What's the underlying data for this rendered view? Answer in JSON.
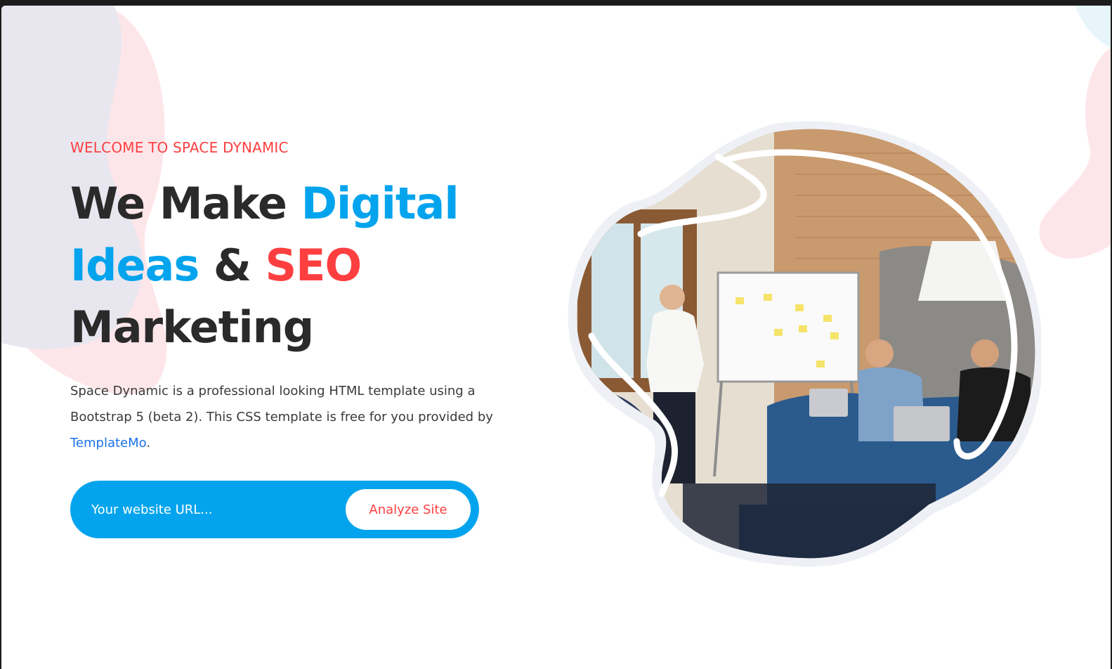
{
  "colors": {
    "accent_blue": "#03a4ed",
    "accent_red": "#fe3f40",
    "dark_text": "#2a2a2a",
    "link_blue": "#1a73e8",
    "blob_pink": "#fde8ea",
    "blob_grey": "#e7e7ef"
  },
  "hero": {
    "eyebrow": "WELCOME TO SPACE DYNAMIC",
    "headline": {
      "part1": "We Make ",
      "part2": "Digital",
      "part3": "Ideas",
      "part4": " & ",
      "part5": "SEO",
      "part6": "Marketing"
    },
    "description": {
      "text_before_link": "Space Dynamic is a professional looking HTML template using a Bootstrap 5 (beta 2). This CSS template is free for you provided by ",
      "link_text": "TemplateMo",
      "text_after_link": "."
    }
  },
  "search": {
    "placeholder": "Your website URL...",
    "value": "",
    "button_label": "Analyze Site"
  },
  "illustration": {
    "icon": "team-meeting-photo-blob"
  }
}
